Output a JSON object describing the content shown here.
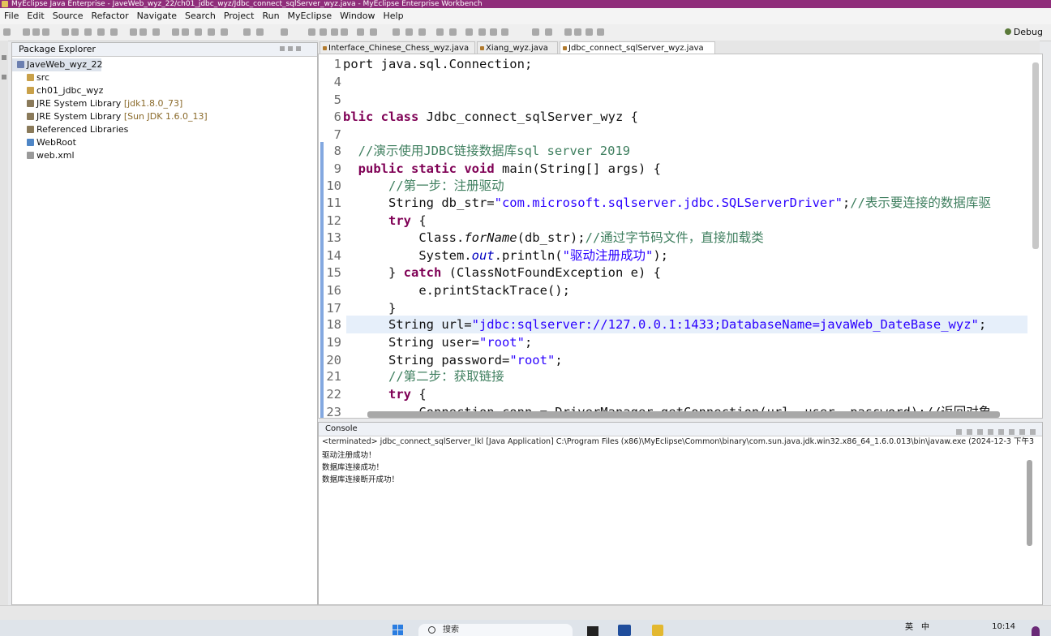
{
  "window": {
    "title": "MyEclipse Java Enterprise - JaveWeb_wyz_22/ch01_jdbc_wyz/Jdbc_connect_sqlServer_wyz.java - MyEclipse Enterprise Workbench"
  },
  "menu": [
    "File",
    "Edit",
    "Source",
    "Refactor",
    "Navigate",
    "Search",
    "Project",
    "Run",
    "MyEclipse",
    "Window",
    "Help"
  ],
  "toolbar": {
    "perspective": "Debug"
  },
  "explorer": {
    "title": "Package Explorer",
    "items": [
      {
        "label": "JaveWeb_wyz_22",
        "extra": ""
      },
      {
        "label": "src",
        "extra": ""
      },
      {
        "label": "ch01_jdbc_wyz",
        "extra": ""
      },
      {
        "label": "JRE System Library",
        "extra": "[jdk1.8.0_73]"
      },
      {
        "label": "JRE System Library",
        "extra": "[Sun JDK 1.6.0_13]"
      },
      {
        "label": "Referenced Libraries",
        "extra": ""
      },
      {
        "label": "WebRoot",
        "extra": ""
      },
      {
        "label": "web.xml",
        "extra": ""
      }
    ]
  },
  "tabs": [
    "Interface_Chinese_Chess_wyz.java",
    "Xiang_wyz.java",
    "Jdbc_connect_sqlServer_wyz.java"
  ],
  "editor": {
    "lines": [
      {
        "n": "1",
        "p": [
          [
            "port java.sql.Connection;",
            ""
          ]
        ]
      },
      {
        "n": "4",
        "p": []
      },
      {
        "n": "5",
        "p": []
      },
      {
        "n": "6",
        "p": [
          [
            "blic ",
            "kw"
          ],
          [
            "class ",
            "kw"
          ],
          [
            "Jdbc_connect_sqlServer_wyz {",
            ""
          ]
        ]
      },
      {
        "n": "7",
        "p": []
      },
      {
        "n": "8",
        "p": [
          [
            "  //演示使用JDBC链接数据库sql server 2019",
            "cm"
          ]
        ]
      },
      {
        "n": "9",
        "p": [
          [
            "  public ",
            "kw"
          ],
          [
            "static ",
            "kw"
          ],
          [
            "void ",
            "kw"
          ],
          [
            "main(String[] args) {",
            ""
          ]
        ]
      },
      {
        "n": "10",
        "p": [
          [
            "      //第一步：注册驱动",
            "cm"
          ]
        ]
      },
      {
        "n": "11",
        "p": [
          [
            "      String db_str=",
            ""
          ],
          [
            "\"com.microsoft.sqlserver.jdbc.SQLServerDriver\"",
            "str"
          ],
          [
            ";",
            ""
          ],
          [
            "//表示要连接的数据库驱",
            "cm"
          ]
        ]
      },
      {
        "n": "12",
        "p": [
          [
            "      ",
            ""
          ],
          [
            "try ",
            "kw"
          ],
          [
            "{",
            ""
          ]
        ]
      },
      {
        "n": "13",
        "p": [
          [
            "          Class.",
            ""
          ],
          [
            "forName",
            "it"
          ],
          [
            "(db_str);",
            ""
          ],
          [
            "//通过字节码文件，直接加载类",
            "cm"
          ]
        ]
      },
      {
        "n": "14",
        "p": [
          [
            "          System.",
            ""
          ],
          [
            "out",
            "fld"
          ],
          [
            ".println(",
            ""
          ],
          [
            "\"驱动注册成功\"",
            "str"
          ],
          [
            ");",
            ""
          ]
        ]
      },
      {
        "n": "15",
        "p": [
          [
            "      } ",
            ""
          ],
          [
            "catch ",
            "kw"
          ],
          [
            "(ClassNotFoundException e) {",
            ""
          ]
        ]
      },
      {
        "n": "16",
        "p": [
          [
            "          e.printStackTrace();",
            ""
          ]
        ]
      },
      {
        "n": "17",
        "p": [
          [
            "      }",
            ""
          ]
        ]
      },
      {
        "n": "18",
        "p": [
          [
            "      String url=",
            ""
          ],
          [
            "\"jdbc:sqlserver://127.0.0.1:1433;DatabaseName=javaWeb_DateBase_wyz\"",
            "str"
          ],
          [
            ";",
            ""
          ]
        ]
      },
      {
        "n": "19",
        "p": [
          [
            "      String user=",
            ""
          ],
          [
            "\"root\"",
            "str"
          ],
          [
            ";",
            ""
          ]
        ]
      },
      {
        "n": "20",
        "p": [
          [
            "      String password=",
            ""
          ],
          [
            "\"root\"",
            "str"
          ],
          [
            ";",
            ""
          ]
        ]
      },
      {
        "n": "21",
        "p": [
          [
            "      //第二步：获取链接",
            "cm"
          ]
        ]
      },
      {
        "n": "22",
        "p": [
          [
            "      ",
            ""
          ],
          [
            "try ",
            "kw"
          ],
          [
            "{",
            ""
          ]
        ]
      },
      {
        "n": "23",
        "p": [
          [
            "          Connection conn = DriverManager.getConnection(url, user, password);//返回对象",
            ""
          ]
        ]
      }
    ]
  },
  "console": {
    "title": "Console",
    "status": "<terminated> jdbc_connect_sqlServer_lkl [Java Application] C:\\Program Files (x86)\\MyEclipse\\Common\\binary\\com.sun.java.jdk.win32.x86_64_1.6.0.013\\bin\\javaw.exe (2024-12-3 下午3",
    "output": [
      "驱动注册成功！",
      "数据库连接成功！",
      "数据库连接断开成功！"
    ]
  },
  "taskbar": {
    "search": "搜索",
    "time": "10:14",
    "tray": [
      "英",
      "中"
    ]
  },
  "colors": {
    "title_bar": "#8f2d7a",
    "keyword": "#7f0055",
    "string": "#2a00ff",
    "comment": "#3f7f5f",
    "highlight": "#e6effa"
  }
}
